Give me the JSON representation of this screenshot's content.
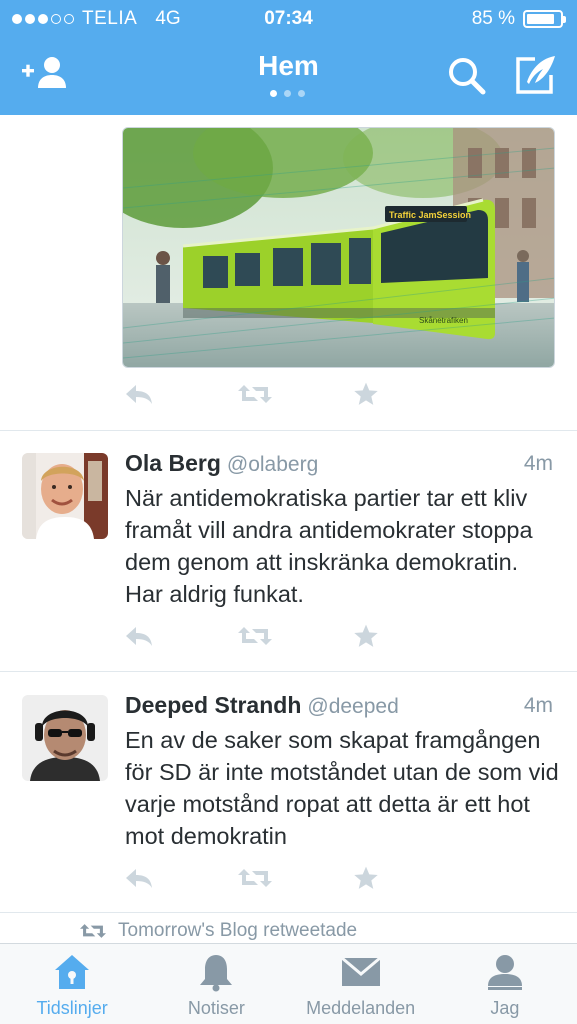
{
  "status_bar": {
    "carrier": "TELIA",
    "network": "4G",
    "time": "07:34",
    "battery": "85 %",
    "battery_level": 0.85,
    "signal_bars_filled": 3,
    "signal_bars_total": 5
  },
  "header": {
    "title": "Hem",
    "page_indicator": {
      "total": 3,
      "active": 0
    },
    "left_icon": "add-user-icon",
    "right_icons": [
      "search-icon",
      "compose-icon"
    ]
  },
  "colors": {
    "brand": "#55acee",
    "text": "#292f33",
    "secondary": "#8899a6",
    "action_icon": "#ccd6dd",
    "divider": "#e1e8ed",
    "tabbar_bg": "#f7f9fa"
  },
  "media_tweet": {
    "image_text": {
      "banner": "Traffic JamSession",
      "brand": "Skånetrafiken"
    },
    "actions": [
      "reply-icon",
      "retweet-icon",
      "favorite-icon"
    ]
  },
  "tweets": [
    {
      "name": "Ola Berg",
      "handle": "@olaberg",
      "time": "4m",
      "text": "När antidemokratiska partier tar ett kliv framåt vill andra antidemokrater stoppa dem genom att inskränka demokratin. Har aldrig funkat."
    },
    {
      "name": "Deeped Strandh",
      "handle": "@deeped",
      "time": "4m",
      "text": "En av de saker som skapat framgången för SD är inte motståndet utan de som vid varje motstånd ropat att detta är ett hot mot demokratin"
    }
  ],
  "partial_tweet": {
    "retweet_note": "Tomorrow's Blog retweetade"
  },
  "tabbar": {
    "tabs": [
      {
        "label": "Tidslinjer",
        "icon": "home-icon",
        "active": true
      },
      {
        "label": "Notiser",
        "icon": "bell-icon",
        "active": false
      },
      {
        "label": "Meddelanden",
        "icon": "envelope-icon",
        "active": false
      },
      {
        "label": "Jag",
        "icon": "person-icon",
        "active": false
      }
    ]
  }
}
